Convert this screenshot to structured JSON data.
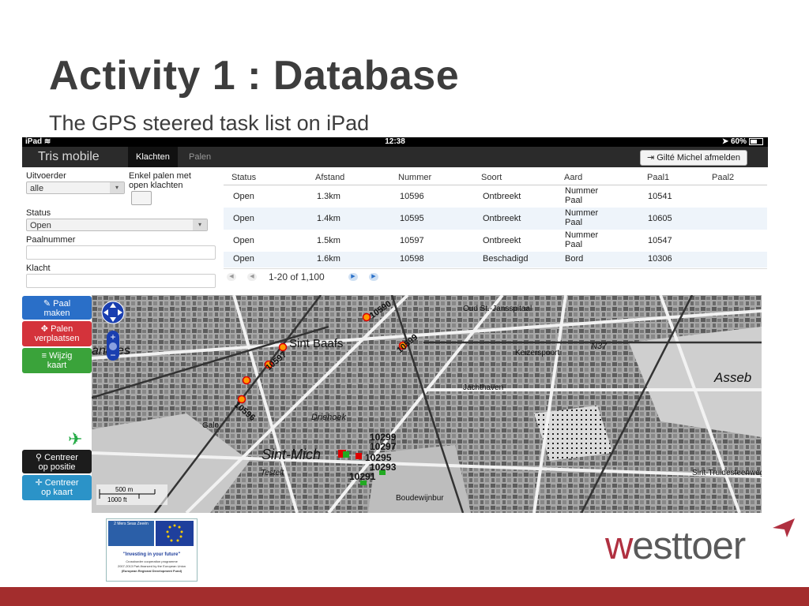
{
  "slide": {
    "title": "Activity 1 : Database",
    "subtitle": "The GPS steered task list on iPad"
  },
  "statusbar": {
    "device": "iPad",
    "time": "12:38",
    "battery": "60%"
  },
  "navbar": {
    "brand": "Tris mobile",
    "tabs": [
      "Klachten",
      "Palen"
    ],
    "active_tab": "Klachten",
    "logout_label": "Gilté Michel afmelden"
  },
  "filters": {
    "uitvoerder_label": "Uitvoerder",
    "uitvoerder_value": "alle",
    "enkel_label_1": "Enkel palen met",
    "enkel_label_2": "open klachten",
    "status_label": "Status",
    "status_value": "Open",
    "paalnummer_label": "Paalnummer",
    "klacht_label": "Klacht"
  },
  "table": {
    "columns": [
      "Status",
      "Afstand",
      "Nummer",
      "Soort",
      "Aard",
      "Paal1",
      "Paal2"
    ],
    "rows": [
      {
        "status": "Open",
        "afstand": "1.3km",
        "nummer": "10596",
        "soort": "Ontbreekt",
        "aard1": "Nummer",
        "aard2": "Paal",
        "paal1": "10541",
        "paal2": ""
      },
      {
        "status": "Open",
        "afstand": "1.4km",
        "nummer": "10595",
        "soort": "Ontbreekt",
        "aard1": "Nummer",
        "aard2": "Paal",
        "paal1": "10605",
        "paal2": ""
      },
      {
        "status": "Open",
        "afstand": "1.5km",
        "nummer": "10597",
        "soort": "Ontbreekt",
        "aard1": "Nummer",
        "aard2": "Paal",
        "paal1": "10547",
        "paal2": ""
      },
      {
        "status": "Open",
        "afstand": "1.6km",
        "nummer": "10598",
        "soort": "Beschadigd",
        "aard1": "Bord",
        "aard2": "",
        "paal1": "10306",
        "paal2": ""
      }
    ],
    "pager_text": "1-20 of 1,100"
  },
  "map_buttons": {
    "paal_maken": [
      "Paal",
      "maken"
    ],
    "palen_verplaatsen": [
      "Palen",
      "verplaatsen"
    ],
    "wijzig_kaart": [
      "Wijzig",
      "kaart"
    ],
    "centreer_positie": [
      "Centreer",
      "op positie"
    ],
    "centreer_kaart": [
      "Centreer",
      "op kaart"
    ]
  },
  "map": {
    "place_labels": [
      "Sint Baafs",
      "Sint-Mich",
      "Asseb",
      "Driehoek",
      "Jachthaven",
      "Boudewijnbur",
      "Keizerspoort",
      "Scharpestraat",
      "Oud St.-Jansspitaal",
      "andres",
      "N37",
      "Testelt",
      "Galo",
      "Sint-Truidesteenweg"
    ],
    "markers": [
      "10590",
      "10596",
      "10597",
      "10595",
      "10599"
    ],
    "cluster_labels": [
      "10299",
      "10297",
      "10295",
      "10293",
      "10291"
    ],
    "scale": [
      "500 m",
      "1000 ft"
    ]
  },
  "logos": {
    "eu_line1": "2 Mers Seas Zeeën",
    "eu_line2": "\"Investing in your future\"",
    "eu_line3": "Crossborder cooperation programme",
    "eu_line4": "2007-2013 Part-financed by the European Union",
    "eu_line5": "(European Regional Development Fund)",
    "brand": "westtoer"
  },
  "colors": {
    "title": "#3d3d3d",
    "footer": "#a32d2d",
    "brand_red": "#b03040",
    "btn_blue": "#2a6fc8",
    "btn_red": "#d4333b",
    "btn_green": "#3aa33a"
  }
}
